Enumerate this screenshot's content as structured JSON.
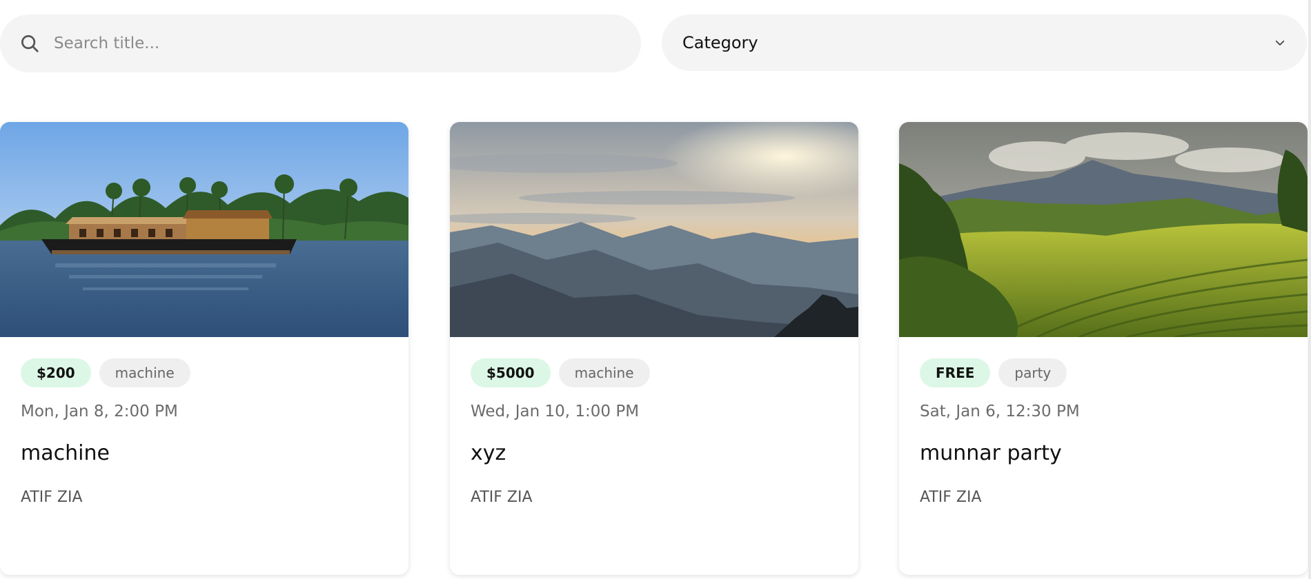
{
  "search": {
    "placeholder": "Search title..."
  },
  "category": {
    "label": "Category"
  },
  "events": [
    {
      "price": "$200",
      "category": "machine",
      "date": "Mon, Jan 8, 2:00 PM",
      "title": "machine",
      "organizer": "ATIF ZIA",
      "image": "houseboat-on-lake"
    },
    {
      "price": "$5000",
      "category": "machine",
      "date": "Wed, Jan 10, 1:00 PM",
      "title": "xyz",
      "organizer": "ATIF ZIA",
      "image": "misty-mountains-sunset"
    },
    {
      "price": "FREE",
      "category": "party",
      "date": "Sat, Jan 6, 12:30 PM",
      "title": "munnar party",
      "organizer": "ATIF ZIA",
      "image": "tea-plantation-hills"
    }
  ]
}
